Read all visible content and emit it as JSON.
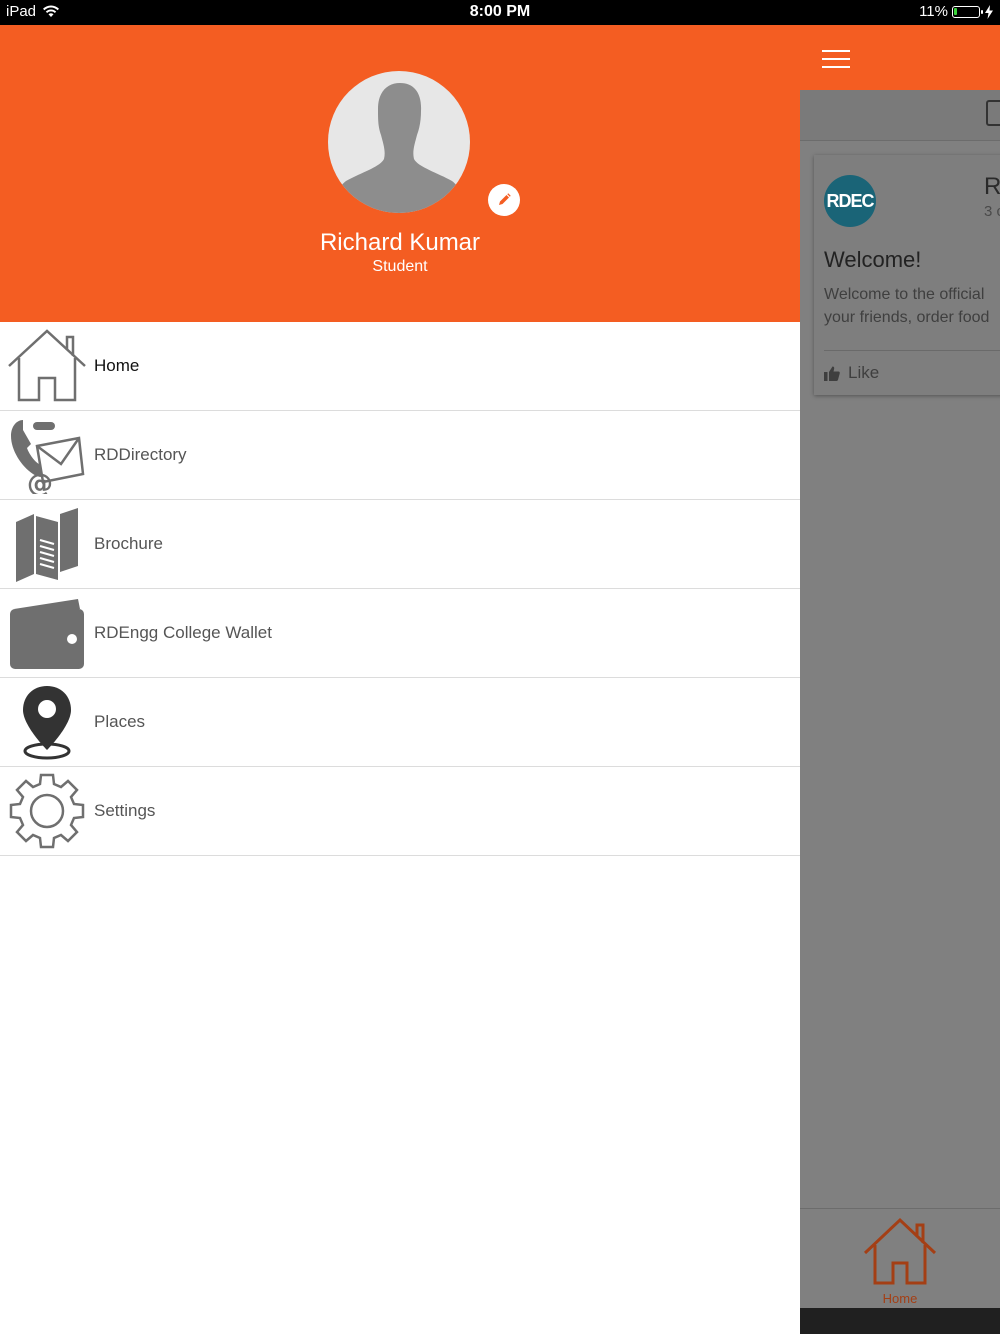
{
  "status_bar": {
    "device": "iPad",
    "time": "8:00 PM",
    "battery_percent_text": "11%",
    "battery_level": 0.11
  },
  "profile": {
    "name": "Richard Kumar",
    "role": "Student"
  },
  "menu": {
    "items": [
      {
        "label": "Home",
        "icon": "house-icon"
      },
      {
        "label": "RDDirectory",
        "icon": "phone-mail-icon"
      },
      {
        "label": "Brochure",
        "icon": "brochure-icon"
      },
      {
        "label": "RDEngg College Wallet",
        "icon": "wallet-icon"
      },
      {
        "label": "Places",
        "icon": "location-pin-icon"
      },
      {
        "label": "Settings",
        "icon": "gear-icon"
      }
    ]
  },
  "background_app": {
    "card": {
      "logo_text": "RDEC",
      "title_partial": "R",
      "subtitle_partial": "3 c",
      "heading": "Welcome!",
      "body_line1": "Welcome to the official",
      "body_line2": "your friends, order food",
      "like_label": "Like"
    },
    "bottom_tab_label": "Home"
  },
  "colors": {
    "brand_orange": "#f45d22",
    "icon_gray": "#6f6f6f",
    "logo_teal": "#1a6477"
  }
}
